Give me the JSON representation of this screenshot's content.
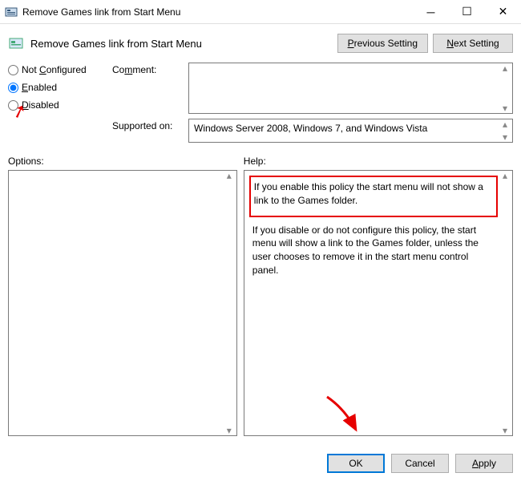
{
  "window": {
    "title": "Remove Games link from Start Menu"
  },
  "header": {
    "title": "Remove Games link from Start Menu",
    "prev": "Previous Setting",
    "next": "Next Setting"
  },
  "radios": {
    "not_configured": "Not Configured",
    "enabled": "Enabled",
    "disabled": "Disabled"
  },
  "fields": {
    "comment_label": "Comment:",
    "comment_value": "",
    "supported_label": "Supported on:",
    "supported_value": "Windows Server 2008, Windows 7, and Windows Vista"
  },
  "lower": {
    "options_label": "Options:",
    "help_label": "Help:",
    "help_p1": "If you enable this policy the start menu will not show a link to the Games folder.",
    "help_p2": "If you disable or do not configure this policy, the start menu will show a link to the Games folder, unless the user chooses to remove it in the start menu control panel."
  },
  "footer": {
    "ok": "OK",
    "cancel": "Cancel",
    "apply": "Apply"
  }
}
